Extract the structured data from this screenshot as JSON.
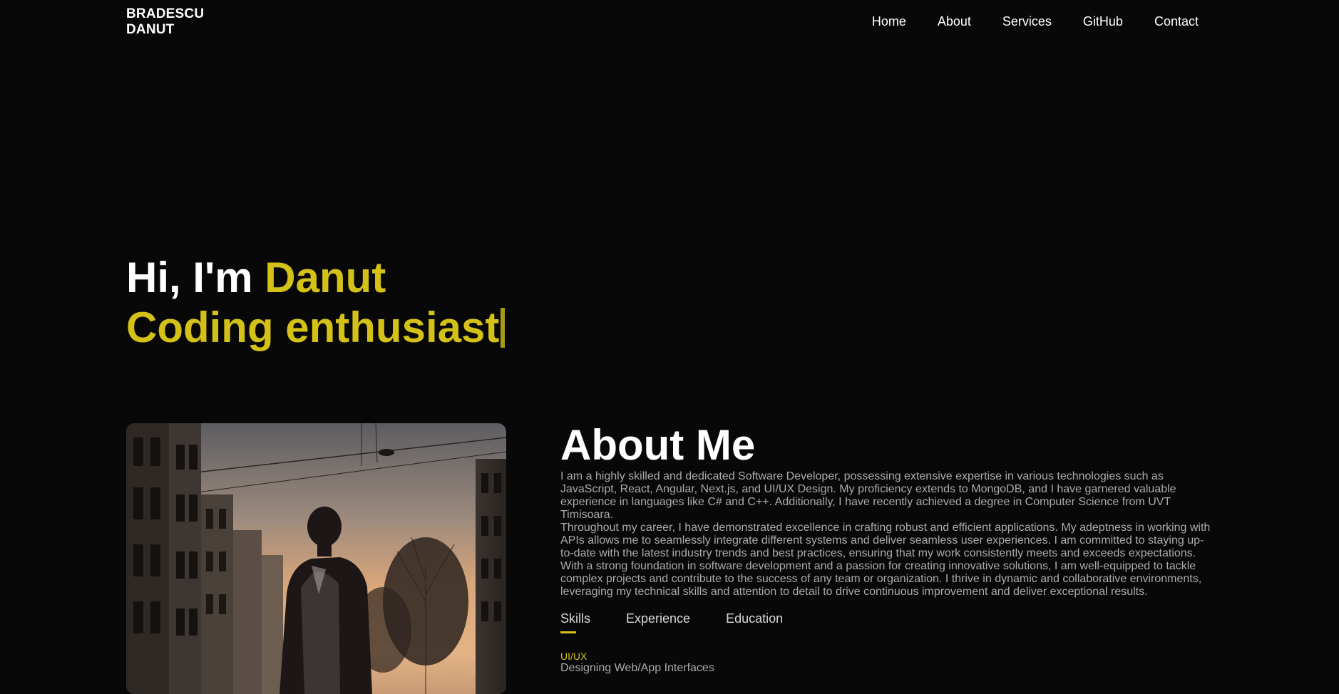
{
  "nav": {
    "logo_line1": "BRADESCU",
    "logo_line2": "DANUT",
    "links": [
      "Home",
      "About",
      "Services",
      "GitHub",
      "Contact"
    ]
  },
  "hero": {
    "greeting": "Hi, I'm ",
    "name": "Danut",
    "subtitle": "Coding enthusiast"
  },
  "about": {
    "title": "About Me",
    "paragraph1": "I am a highly skilled and dedicated Software Developer, possessing extensive expertise in various technologies such as JavaScript, React, Angular, Next.js, and UI/UX Design. My proficiency extends to MongoDB, and I have garnered valuable experience in languages like C# and C++. Additionally, I have recently achieved a degree in Computer Science from UVT Timisoara.",
    "paragraph2": "Throughout my career, I have demonstrated excellence in crafting robust and efficient applications. My adeptness in working with APIs allows me to seamlessly integrate different systems and deliver seamless user experiences. I am committed to staying up-to-date with the latest industry trends and best practices, ensuring that my work consistently meets and exceeds expectations. With a strong foundation in software development and a passion for creating innovative solutions, I am well-equipped to tackle complex projects and contribute to the success of any team or organization. I thrive in dynamic and collaborative environments, leveraging my technical skills and attention to detail to drive continuous improvement and deliver exceptional results.",
    "tabs": [
      "Skills",
      "Experience",
      "Education"
    ],
    "active_tab": "Skills",
    "skill_name": "UI/UX",
    "skill_desc": "Designing Web/App Interfaces"
  },
  "colors": {
    "accent": "#d4c118",
    "background": "#080808",
    "body_text": "#ababab"
  }
}
